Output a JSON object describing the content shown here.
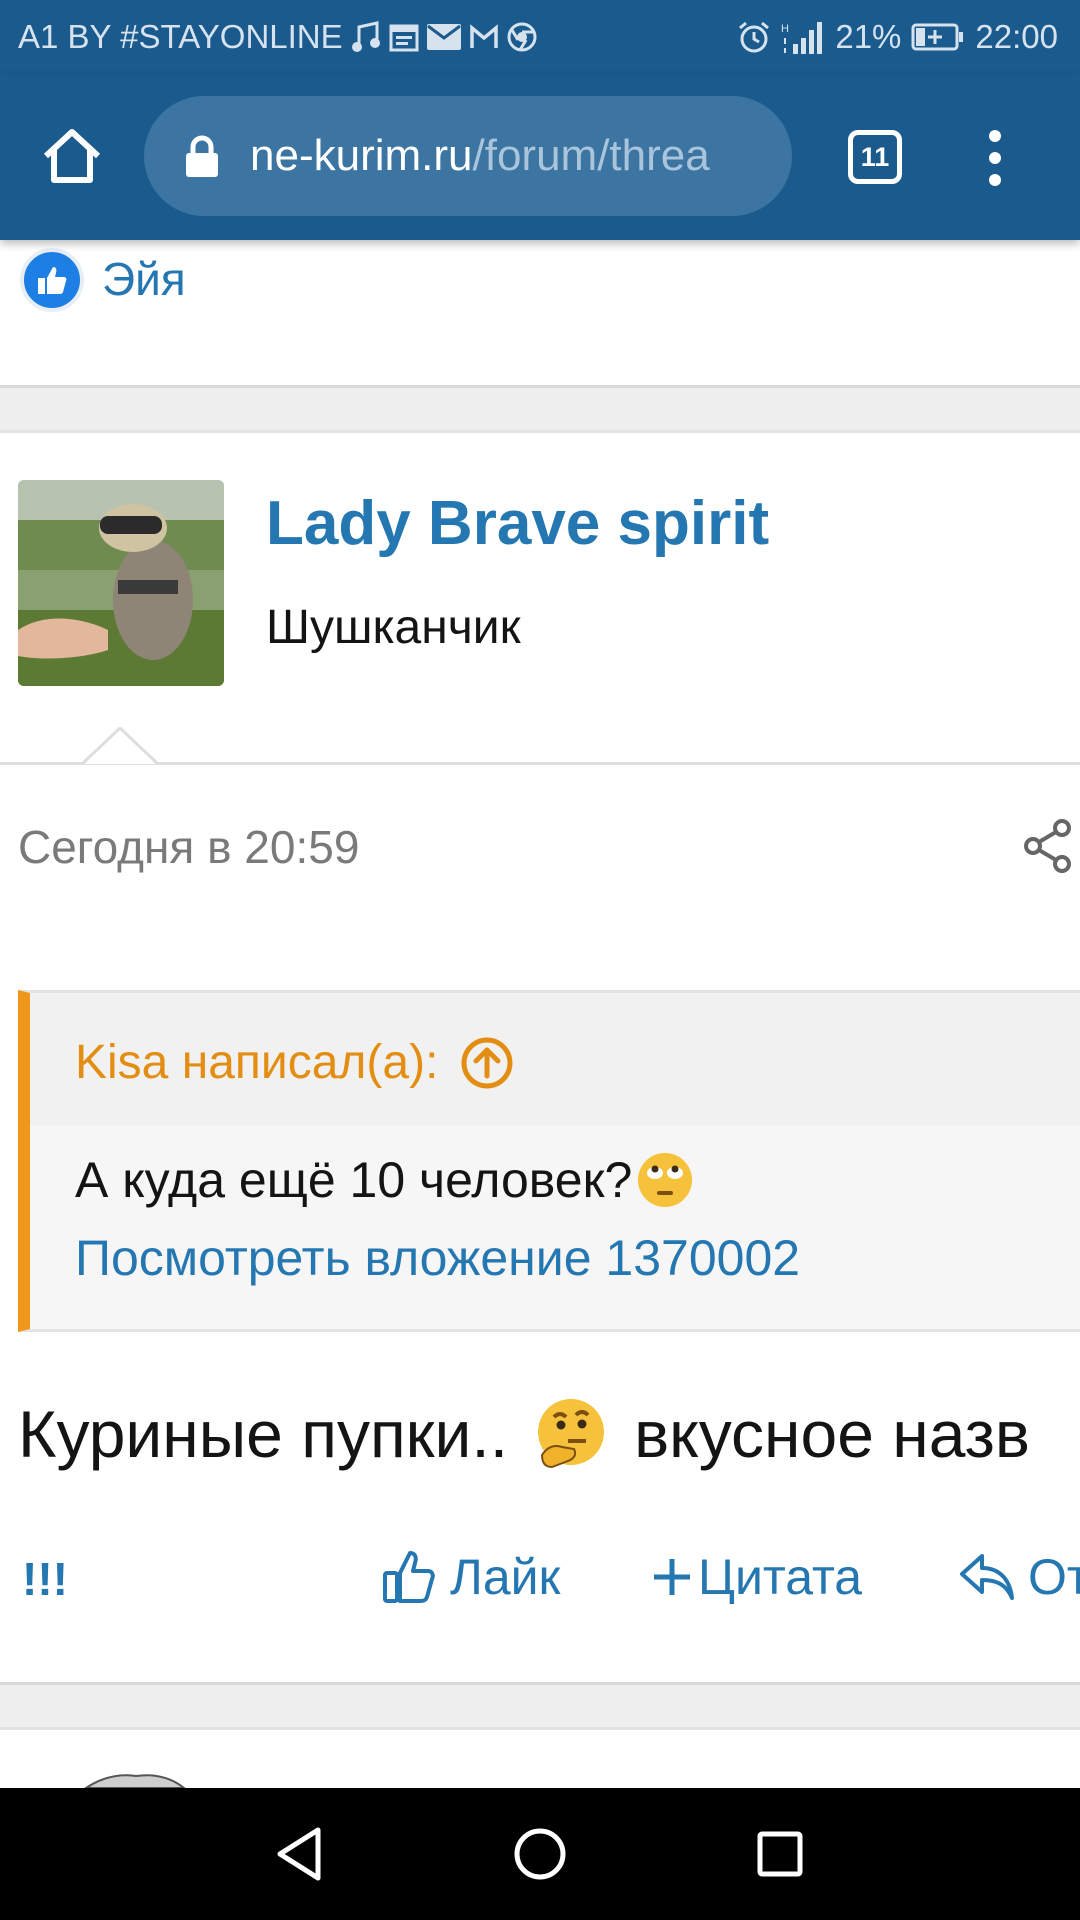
{
  "status_bar": {
    "carrier": "A1 BY #STAYONLINE",
    "battery": "21%",
    "time": "22:00"
  },
  "browser": {
    "url_domain": "ne-kurim.ru",
    "url_path": "/forum/threa",
    "tab_count": "11"
  },
  "reaction": {
    "reactor": "Эйя"
  },
  "post": {
    "author": "Lady Brave spirit",
    "author_title": "Шушканчик",
    "date": "Сегодня в 20:59",
    "quote": {
      "author": "Kisa написал(а):",
      "text": "А куда ещё 10 человек?",
      "attachment": "Посмотреть вложение 1370002"
    },
    "body_start": "Куриные пупки..",
    "body_end": "вкусное назв"
  },
  "actions": {
    "bang": "!!!",
    "like": "Лайк",
    "quote": "Цитата",
    "reply": "От"
  },
  "colors": {
    "brand": "#1b5a8d",
    "link": "#2577b1",
    "quote_accent": "#f0961b"
  }
}
